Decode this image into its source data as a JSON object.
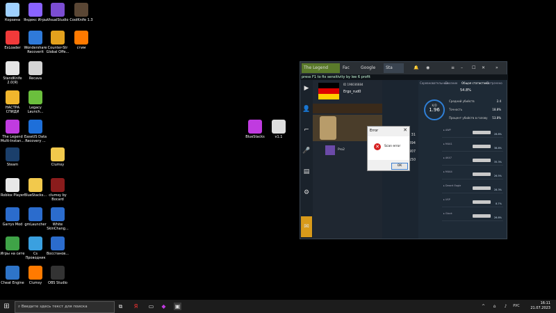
{
  "desktop": {
    "icons": [
      {
        "label": "Корзина",
        "color": "#9fd1ff"
      },
      {
        "label": "Яндекс Игры",
        "color": "#8a63ff"
      },
      {
        "label": "VisualStudio",
        "color": "#7b4dd1"
      },
      {
        "label": "CoolKnife 1.3",
        "color": "#5a4634"
      },
      {
        "label": "ExLoader",
        "color": "#f03a3a"
      },
      {
        "label": "Wondershare Recoverit",
        "color": "#2f7ad9"
      },
      {
        "label": "Counter-Str Global Offe...",
        "color": "#e3a11d"
      },
      {
        "label": "стим",
        "color": "#ff7a00"
      },
      {
        "label": "StandKnife 2.0(Я)",
        "color": "#e6e6e6"
      },
      {
        "label": "Recava",
        "color": "#d4d4d4"
      },
      {
        "label": "НАСТРА СПИДИ",
        "color": "#f0b62d"
      },
      {
        "label": "Legacy Launch...",
        "color": "#6bbf3d"
      },
      {
        "label": "The Legend Multi-Instan...",
        "color": "#c03be0"
      },
      {
        "label": "EaseUS Data Recovery ...",
        "color": "#1e6fd9"
      },
      {
        "label": "Steam",
        "color": "#1b3f6b"
      },
      {
        "label": "Clumsy",
        "color": "#f2c94c"
      },
      {
        "label": "Roblox Player",
        "color": "#e8e8e8"
      },
      {
        "label": "BlueStacks...",
        "color": "#f2c94c"
      },
      {
        "label": "clumsy by Bocard",
        "color": "#8a1c1c"
      },
      {
        "label": "Garrys Mod",
        "color": "#2b6ccd"
      },
      {
        "label": "gmLauncher",
        "color": "#2b6ccd"
      },
      {
        "label": "White SkinChang...",
        "color": "#2b6ccd"
      },
      {
        "label": "Игры на сите",
        "color": "#3fa347"
      },
      {
        "label": "Cs Проводник",
        "color": "#3aa0e0"
      },
      {
        "label": "Восстанов...",
        "color": "#2b6ccd"
      },
      {
        "label": "Cheat Engine",
        "color": "#2e74c8"
      },
      {
        "label": "Clumsy",
        "color": "#ff7a00"
      },
      {
        "label": "OBS Studio",
        "color": "#333333"
      },
      {
        "label": "BlueStacks",
        "color": "#c03be0"
      },
      {
        "label": "v1.1",
        "color": "#dddddd"
      }
    ]
  },
  "window": {
    "tabs": [
      "The Legend",
      "Fac",
      "Google",
      "Sta"
    ],
    "url": "press F1 to fix sensitivity by lee 6 profit",
    "player": {
      "id": "ID 196036684",
      "name": "Ergo_rud0",
      "clan": "Pro2"
    },
    "section_tabs": [
      "Соревновательный",
      "Союзник",
      "Общая статистика",
      "Потрачено"
    ],
    "kd": "1.96",
    "kd_label": "K/D",
    "rank_text": "54.8%",
    "stats": [
      {
        "label": "Средний убийств",
        "value": "2.4"
      },
      {
        "label": "Точность",
        "value": "18.8%"
      },
      {
        "label": "Процент убийств в голову",
        "value": "53.8%"
      }
    ],
    "numbers": [
      "31",
      "5894",
      "907",
      "150"
    ],
    "weapons": [
      {
        "name": "▸ AWP",
        "pct": "28.8%"
      },
      {
        "name": "▸ M4A1",
        "pct": "38.8%"
      },
      {
        "name": "▸ AK47",
        "pct": "35.3%"
      },
      {
        "name": "▸ M4A4",
        "pct": "26.5%"
      },
      {
        "name": "▸ Desert Eagle",
        "pct": "28.3%"
      },
      {
        "name": "▸ USP",
        "pct": "8.7%"
      },
      {
        "name": "▸ Glock",
        "pct": "26.8%"
      }
    ]
  },
  "dialog": {
    "title": "Error",
    "message": "Scan error",
    "ok": "OK"
  },
  "taskbar": {
    "search_placeholder": "Введите здесь текст для поиска",
    "lang": "РУС",
    "time": "16:11",
    "date": "21.07.2023"
  }
}
